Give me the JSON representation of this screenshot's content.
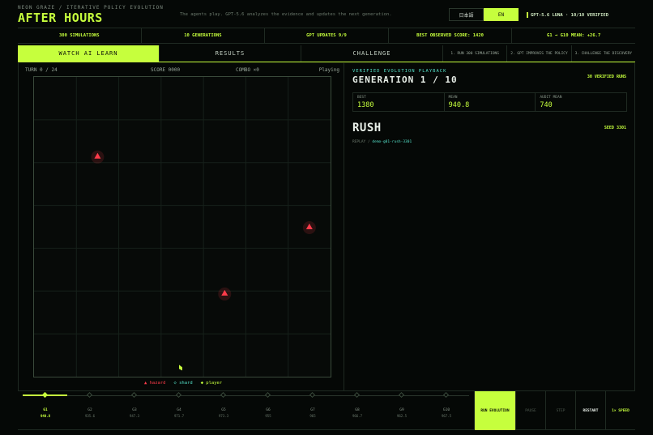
{
  "header": {
    "subtitle": "NEON GRAZE / ITERATIVE POLICY EVOLUTION",
    "title": "AFTER HOURS",
    "tagline": "The agents play. GPT-5.6 analyzes the evidence and updates the next generation.",
    "lang_options": [
      "日本語",
      "EN"
    ],
    "lang_selected": "EN",
    "model_badge": "GPT-5.6 LUNA · 10/10 VERIFIED"
  },
  "stats": [
    "300 SIMULATIONS",
    "10 GENERATIONS",
    "GPT UPDATES 9/9",
    "BEST OBSERVED SCORE: 1420",
    "G1 → G10 MEAN: +26.7"
  ],
  "tabs": [
    {
      "label": "WATCH AI LEARN",
      "active": true
    },
    {
      "label": "RESULTS",
      "active": false
    },
    {
      "label": "CHALLENGE",
      "active": false
    }
  ],
  "steps": [
    "1. RUN 300 SIMULATIONS",
    "2. GPT IMPROVES THE POLICY",
    "3. CHALLENGE THE DISCOVERY"
  ],
  "game": {
    "turn": "TURN 0 / 24",
    "score": "SCORE 0000",
    "combo": "COMBO ×0",
    "status": "Playing",
    "grid_cols": 7,
    "grid_rows": 7,
    "hazards": [
      {
        "col": 1.5,
        "row": 1.85
      },
      {
        "col": 6.5,
        "row": 3.5
      },
      {
        "col": 4.5,
        "row": 5.05
      }
    ],
    "player": {
      "col": 3.5,
      "row": 6.8
    },
    "legend": {
      "hazard": "▲ hazard",
      "shard": "◇ shard",
      "player": "◆ player"
    },
    "colors": {
      "hazard": "#ff3b4a",
      "shard": "#54e0c8",
      "player": "#c6ff3d"
    }
  },
  "playback": {
    "eyebrow": "VERIFIED EVOLUTION PLAYBACK",
    "generation": "GENERATION 1 / 10",
    "verified_runs": "30 VERIFIED RUNS",
    "metrics": [
      {
        "label": "BEST",
        "value": "1380"
      },
      {
        "label": "MEAN",
        "value": "940.8"
      },
      {
        "label": "AUDIT MEAN",
        "value": "740"
      }
    ],
    "policy": "RUSH",
    "seed": "SEED 3301",
    "replay_label": "REPLAY /",
    "replay_code": "demo-g01-rush-3301"
  },
  "timeline": {
    "generations": [
      {
        "label": "G1",
        "value": "940.8",
        "active": true
      },
      {
        "label": "G2",
        "value": "935.6",
        "active": false
      },
      {
        "label": "G3",
        "value": "947.3",
        "active": false
      },
      {
        "label": "G4",
        "value": "971.7",
        "active": false
      },
      {
        "label": "G5",
        "value": "973.3",
        "active": false
      },
      {
        "label": "G6",
        "value": "955",
        "active": false
      },
      {
        "label": "G7",
        "value": "965",
        "active": false
      },
      {
        "label": "G8",
        "value": "966.7",
        "active": false
      },
      {
        "label": "G9",
        "value": "962.5",
        "active": false
      },
      {
        "label": "G10",
        "value": "967.5",
        "active": false
      }
    ],
    "progress": 0.1
  },
  "controls": {
    "run": "RUN EVOLUTION",
    "pause": "PAUSE",
    "step": "STEP",
    "restart": "RESTART",
    "speed": "1× SPEED"
  },
  "theme": {
    "accent": "#c6ff3d",
    "teal": "#54e0c8",
    "danger": "#ff3b4a",
    "bg": "#050806"
  }
}
